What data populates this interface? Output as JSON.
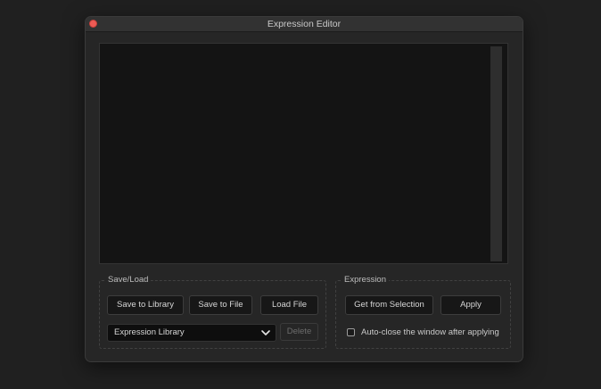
{
  "window": {
    "title": "Expression Editor"
  },
  "editor": {
    "content": ""
  },
  "save_load": {
    "label": "Save/Load",
    "save_to_library": "Save to Library",
    "save_to_file": "Save to File",
    "load_file": "Load File",
    "library_select": {
      "selected": "Expression Library"
    },
    "delete": "Delete"
  },
  "expression": {
    "label": "Expression",
    "get_from_selection": "Get from Selection",
    "apply": "Apply",
    "auto_close": {
      "label": "Auto-close the window after applying",
      "checked": false
    }
  },
  "colors": {
    "close_button": "#ee5b55",
    "background": "#202020",
    "window": "#262626",
    "editor": "#141414"
  }
}
